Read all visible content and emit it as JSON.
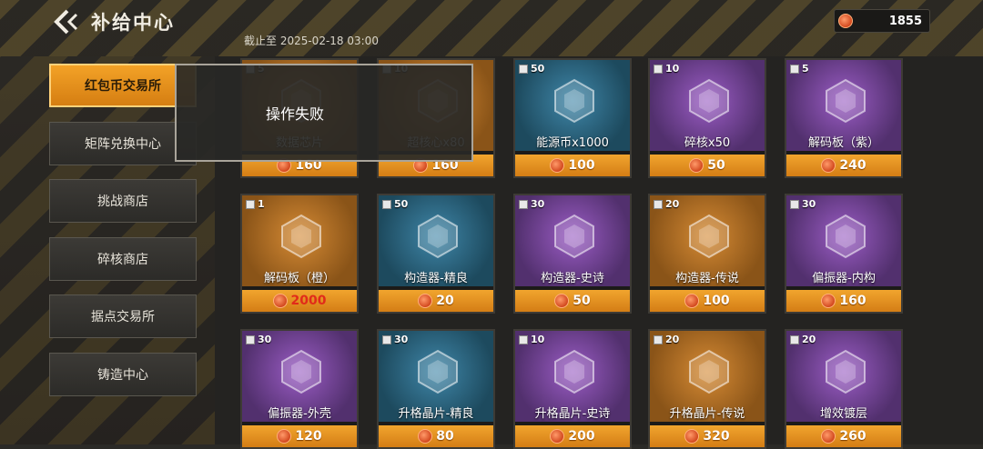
{
  "header": {
    "title": "补给中心",
    "deadline": "截止至 2025-02-18 03:00"
  },
  "currency": {
    "amount": "1855",
    "icon": "coin-icon"
  },
  "sidebar": {
    "items": [
      {
        "label": "红包币交易所",
        "active": true
      },
      {
        "label": "矩阵兑换中心",
        "active": false
      },
      {
        "label": "挑战商店",
        "active": false
      },
      {
        "label": "碎核商店",
        "active": false
      },
      {
        "label": "据点交易所",
        "active": false
      },
      {
        "label": "铸造中心",
        "active": false
      }
    ]
  },
  "toast": {
    "message": "操作失败"
  },
  "items": [
    {
      "qty": "5",
      "name": "数据芯片",
      "price": "160",
      "rarity": "orange",
      "icon": "chip-icon"
    },
    {
      "qty": "10",
      "name": "超核心x80",
      "price": "160",
      "rarity": "orange",
      "icon": "core-icon"
    },
    {
      "qty": "50",
      "name": "能源币x1000",
      "price": "100",
      "rarity": "blue",
      "icon": "energy-icon"
    },
    {
      "qty": "10",
      "name": "碎核x50",
      "price": "50",
      "rarity": "purple",
      "icon": "shard-icon"
    },
    {
      "qty": "5",
      "name": "解码板（紫）",
      "price": "240",
      "rarity": "purple",
      "icon": "board-icon"
    },
    {
      "qty": "1",
      "name": "解码板（橙）",
      "price": "2000",
      "rarity": "orange",
      "icon": "board-icon",
      "price_red": true
    },
    {
      "qty": "50",
      "name": "构造器-精良",
      "price": "20",
      "rarity": "blue",
      "icon": "cube-icon"
    },
    {
      "qty": "30",
      "name": "构造器-史诗",
      "price": "50",
      "rarity": "purple",
      "icon": "cube-icon"
    },
    {
      "qty": "20",
      "name": "构造器-传说",
      "price": "100",
      "rarity": "orange",
      "icon": "cube-icon"
    },
    {
      "qty": "30",
      "name": "偏振器-内构",
      "price": "160",
      "rarity": "purple",
      "icon": "crystal-icon"
    },
    {
      "qty": "30",
      "name": "偏振器-外壳",
      "price": "120",
      "rarity": "purple",
      "icon": "shell-icon"
    },
    {
      "qty": "30",
      "name": "升格晶片-精良",
      "price": "80",
      "rarity": "blue",
      "icon": "chip-icon"
    },
    {
      "qty": "10",
      "name": "升格晶片-史诗",
      "price": "200",
      "rarity": "purple",
      "icon": "chip-icon"
    },
    {
      "qty": "20",
      "name": "升格晶片-传说",
      "price": "320",
      "rarity": "orange",
      "icon": "chip-icon"
    },
    {
      "qty": "20",
      "name": "增效镀层",
      "price": "260",
      "rarity": "purple",
      "icon": "spray-icon"
    }
  ]
}
